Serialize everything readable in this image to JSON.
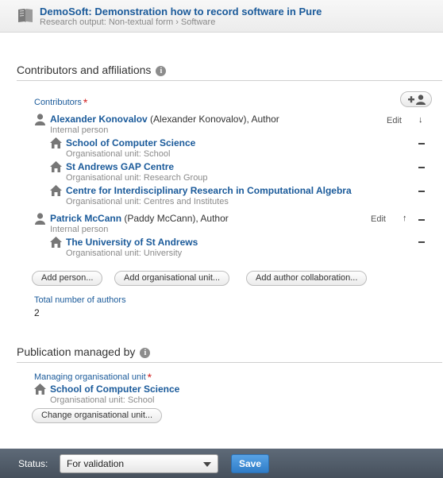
{
  "header": {
    "title": "DemoSoft: Demonstration how to record software in Pure",
    "breadcrumb": "Research output: Non-textual form › Software",
    "icon": "book-icon"
  },
  "contributors_section": {
    "title": "Contributors and affiliations",
    "field_label": "Contributors",
    "required_mark": "*",
    "add_icon": "add-person-icon",
    "contributors": [
      {
        "name": "Alexander Konovalov",
        "rest": " (Alexander Konovalov), Author",
        "type": "Internal person",
        "edit_label": "Edit",
        "arrow": "↓",
        "units": [
          {
            "name": "School of Computer Science",
            "type": "Organisational unit: School"
          },
          {
            "name": "St Andrews GAP Centre",
            "type": "Organisational unit: Research Group"
          },
          {
            "name": "Centre for Interdisciplinary Research in Computational Algebra",
            "type": "Organisational unit: Centres and Institutes"
          }
        ]
      },
      {
        "name": "Patrick McCann",
        "rest": " (Paddy McCann), Author",
        "type": "Internal person",
        "edit_label": "Edit",
        "arrow": "↑",
        "units": [
          {
            "name": "The University of St Andrews",
            "type": "Organisational unit: University"
          }
        ]
      }
    ],
    "buttons": {
      "add_person": "Add person...",
      "add_unit": "Add organisational unit...",
      "add_collab": "Add author collaboration..."
    },
    "total_label": "Total number of authors",
    "total_value": "2"
  },
  "managed_section": {
    "title": "Publication managed by",
    "field_label": "Managing organisational unit",
    "required_mark": "*",
    "unit_name": "School of Computer Science",
    "unit_type": "Organisational unit: School",
    "change_button": "Change organisational unit..."
  },
  "footer": {
    "status_label": "Status:",
    "status_value": "For validation",
    "save_label": "Save"
  },
  "colors": {
    "link": "#1a5a9a",
    "required": "#d12020",
    "footer": "#4f5a66",
    "save": "#3a86cf"
  }
}
